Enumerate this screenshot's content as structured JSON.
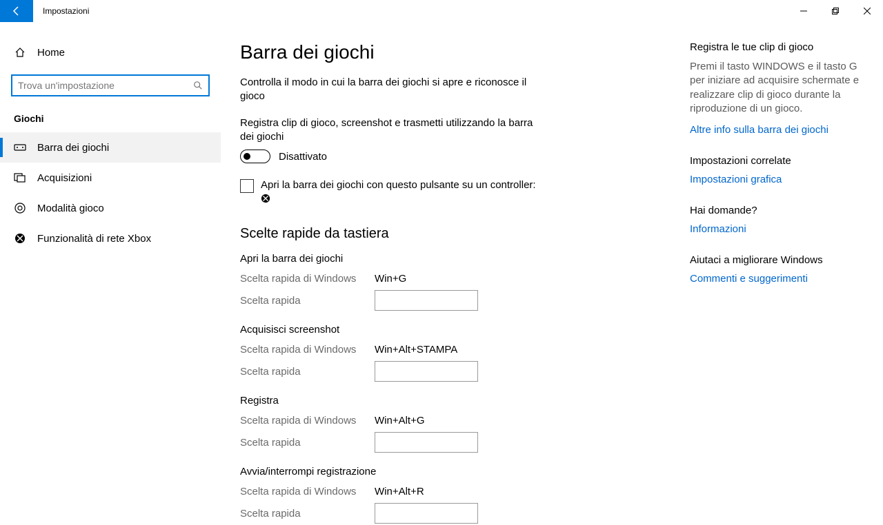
{
  "window": {
    "title": "Impostazioni"
  },
  "sidebar": {
    "home": "Home",
    "search_placeholder": "Trova un'impostazione",
    "section": "Giochi",
    "items": [
      {
        "label": "Barra dei giochi",
        "icon": "gamebar"
      },
      {
        "label": "Acquisizioni",
        "icon": "capture"
      },
      {
        "label": "Modalità gioco",
        "icon": "gamemode"
      },
      {
        "label": "Funzionalità di rete Xbox",
        "icon": "xbox"
      }
    ]
  },
  "main": {
    "title": "Barra dei giochi",
    "desc": "Controlla il modo in cui la barra dei giochi si apre e riconosce il gioco",
    "toggle_desc": "Registra clip di gioco, screenshot e trasmetti utilizzando la barra dei giochi",
    "toggle_state": "Disattivato",
    "checkbox_label": "Apri la barra dei giochi con questo pulsante su un controller:",
    "shortcuts_heading": "Scelte rapide da tastiera",
    "windows_shortcut_label": "Scelta rapida di Windows",
    "user_shortcut_label": "Scelta rapida",
    "shortcuts": [
      {
        "title": "Apri la barra dei giochi",
        "value": "Win+G"
      },
      {
        "title": "Acquisisci screenshot",
        "value": "Win+Alt+STAMPA"
      },
      {
        "title": "Registra",
        "value": "Win+Alt+G"
      },
      {
        "title": "Avvia/interrompi registrazione",
        "value": "Win+Alt+R"
      }
    ]
  },
  "aside": {
    "s1_title": "Registra le tue clip di gioco",
    "s1_text": "Premi il tasto WINDOWS e il tasto G per iniziare ad acquisire schermate e realizzare clip di gioco durante la riproduzione di un gioco.",
    "s1_link": "Altre info sulla barra dei giochi",
    "s2_title": "Impostazioni correlate",
    "s2_link": "Impostazioni grafica",
    "s3_title": "Hai domande?",
    "s3_link": "Informazioni",
    "s4_title": "Aiutaci a migliorare Windows",
    "s4_link": "Commenti e suggerimenti"
  }
}
